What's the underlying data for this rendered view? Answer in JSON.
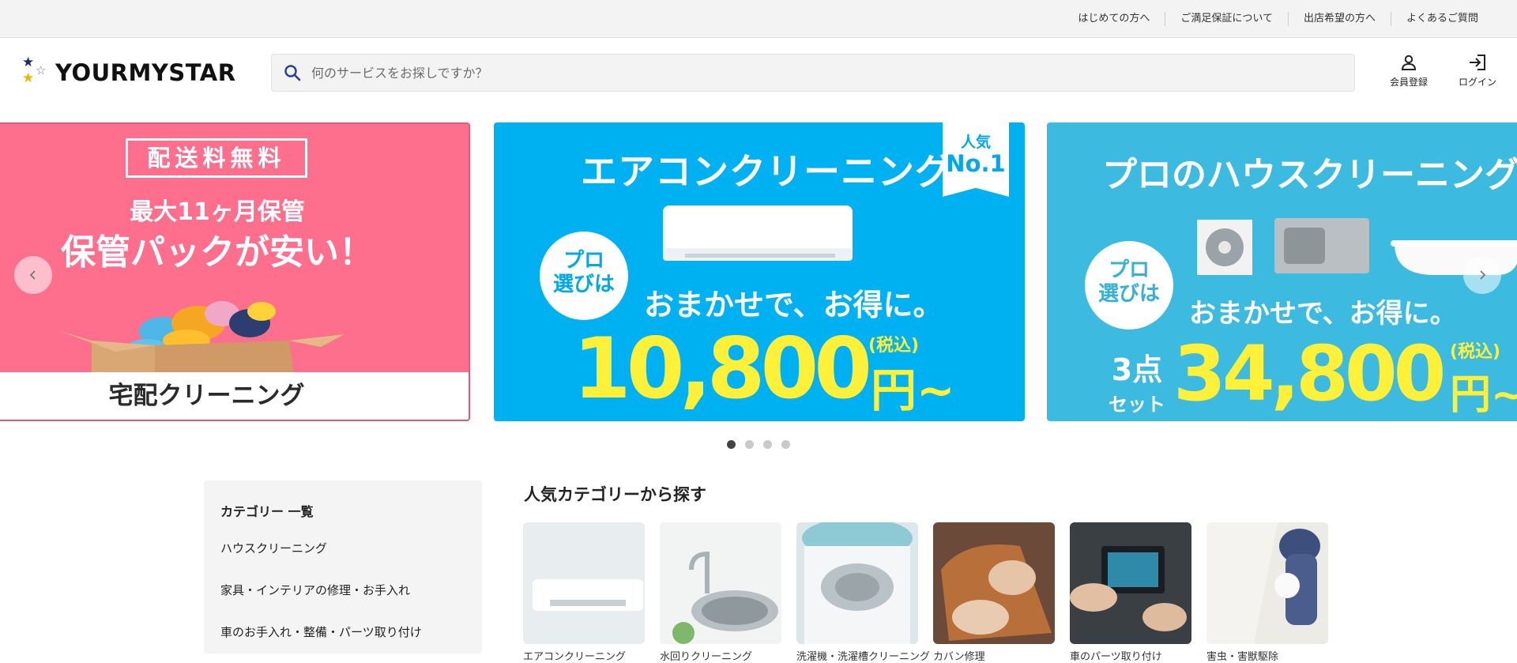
{
  "topbar": {
    "links": [
      "はじめての方へ",
      "ご満足保証について",
      "出店希望の方へ",
      "よくあるご質問"
    ]
  },
  "header": {
    "logo_text": "YOURMYSTAR",
    "search_placeholder": "何のサービスをお探しですか？",
    "register_label": "会員登録",
    "login_label": "ログイン"
  },
  "carousel": {
    "slides": [
      {
        "badge": "配送料無料",
        "subtitle": "最大11ヶ月保管",
        "headline": "保管パックが安い！",
        "footer": "宅配クリーニング"
      },
      {
        "title": "エアコンクリーニング",
        "rank_top": "人気",
        "rank_bottom": "No.1",
        "bubble": "プロ\n選びは",
        "catch": "おまかせで、お得に。",
        "price": "10,800",
        "yen": "円~",
        "tax": "(税込)"
      },
      {
        "title": "プロのハウスクリーニング",
        "bubble": "プロ\n選びは",
        "catch": "おまかせで、お得に。",
        "set_top": "3点",
        "set_bottom": "セット",
        "price": "34,800",
        "yen": "円~",
        "tax": "(税込)"
      }
    ],
    "dot_count": 4,
    "active_dot": 0
  },
  "categories": {
    "title": "カテゴリー 一覧",
    "items": [
      "ハウスクリーニング",
      "家具・インテリアの修理・お手入れ",
      "車のお手入れ・整備・パーツ取り付け"
    ]
  },
  "popular": {
    "title": "人気カテゴリーから探す",
    "tiles": [
      "エアコンクリーニング",
      "水回りクリーニング",
      "洗濯機・洗濯槽クリーニング",
      "カバン修理",
      "車のパーツ取り付け",
      "害虫・害獣駆除"
    ]
  },
  "colors": {
    "slide1_bg": "#fe6f8d",
    "slide2_bg": "#00b1f2",
    "slide3_bg": "#3dbae0",
    "price_yellow": "#fff03a",
    "logo_navy": "#1c2a6b",
    "logo_gold": "#f3b400"
  }
}
